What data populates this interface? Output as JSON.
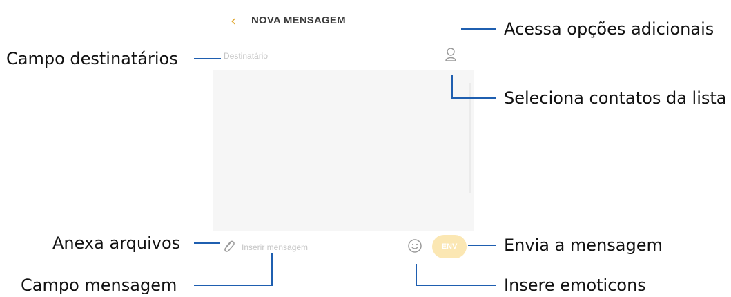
{
  "screen": {
    "title": "NOVA MENSAGEM",
    "recipient_placeholder": "Destinatário",
    "message_placeholder": "Inserir mensagem",
    "send_label": "ENV"
  },
  "callouts": {
    "more_options": "Acessa opções adicionais",
    "recipients_field": "Campo destinatários",
    "select_contacts": "Seleciona contatos da lista",
    "attach_files": "Anexa arquivos",
    "send_message": "Envia a mensagem",
    "message_field": "Campo mensagem",
    "insert_emoticons": "Insere emoticons"
  },
  "colors": {
    "accent": "#e0a52a",
    "send_button": "#fbe7b3",
    "body_background": "#f6f6f6",
    "leader_line": "#1f5fb0"
  },
  "icons": [
    "back-arrow-icon",
    "contact-icon",
    "paperclip-icon",
    "smiley-icon"
  ]
}
